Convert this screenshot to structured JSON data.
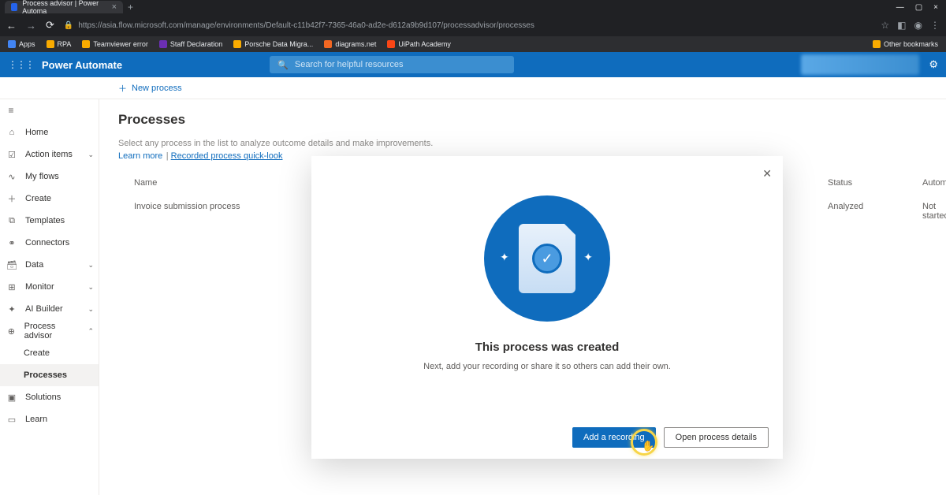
{
  "browser": {
    "tab_title": "Process advisor | Power Automa",
    "url": "https://asia.flow.microsoft.com/manage/environments/Default-c11b42f7-7365-46a0-ad2e-d612a9b9d107/processadvisor/processes",
    "bookmarks": {
      "apps": "Apps",
      "items": [
        "RPA",
        "Teamviewer error",
        "Staff Declaration",
        "Porsche Data Migra...",
        "diagrams.net",
        "UiPath Academy"
      ],
      "other": "Other bookmarks"
    }
  },
  "header": {
    "product": "Power Automate",
    "search_placeholder": "Search for helpful resources"
  },
  "cmdbar": {
    "new_process": "New process"
  },
  "nav": {
    "home": "Home",
    "action_items": "Action items",
    "my_flows": "My flows",
    "create": "Create",
    "templates": "Templates",
    "connectors": "Connectors",
    "data": "Data",
    "monitor": "Monitor",
    "ai_builder": "AI Builder",
    "process_advisor": "Process advisor",
    "pa_create": "Create",
    "pa_processes": "Processes",
    "solutions": "Solutions",
    "learn": "Learn"
  },
  "page": {
    "title": "Processes",
    "desc": "Select any process in the list to analyze outcome details and make improvements.",
    "learn_more": "Learn more",
    "quick_look": "Recorded process quick-look",
    "columns": {
      "name": "Name",
      "status": "Status",
      "automation": "Automatio"
    },
    "rows": [
      {
        "name": "Invoice submission process",
        "status": "Analyzed",
        "automation": "Not started"
      }
    ]
  },
  "modal": {
    "title": "This process was created",
    "desc": "Next, add your recording or share it so others can add their own.",
    "primary": "Add a recording",
    "secondary": "Open process details"
  }
}
